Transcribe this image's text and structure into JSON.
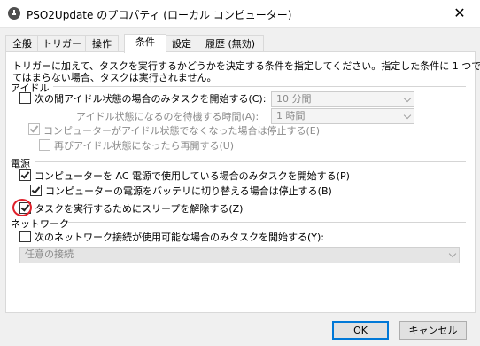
{
  "window": {
    "title": "PSO2Update のプロパティ (ローカル コンピューター)",
    "close_glyph": "✕",
    "icon": "clock-icon"
  },
  "tabs": [
    {
      "label": "全般"
    },
    {
      "label": "トリガー"
    },
    {
      "label": "操作"
    },
    {
      "label": "条件",
      "active": true
    },
    {
      "label": "設定"
    },
    {
      "label": "履歴 (無効)"
    }
  ],
  "description": {
    "line1": "トリガーに加えて、タスクを実行するかどうかを決定する条件を指定してください。指定した条件に 1 つでもあ",
    "line2": "てはまらない場合、タスクは実行されません。"
  },
  "idle": {
    "header": "アイドル",
    "start_only_if_idle": {
      "label": "次の間アイドル状態の場合のみタスクを開始する(C):",
      "checked": false
    },
    "idle_for": "10 分間",
    "wait_for_idle_label": "アイドル状態になるのを待機する時間(A):",
    "wait_for_idle": "1 時間",
    "stop_if_not_idle": {
      "label": "コンピューターがアイドル状態でなくなった場合は停止する(E)",
      "checked": true
    },
    "restart_if_idle": {
      "label": "再びアイドル状態になったら再開する(U)",
      "checked": false
    }
  },
  "power": {
    "header": "電源",
    "ac_only": {
      "label": "コンピューターを AC 電源で使用している場合のみタスクを開始する(P)",
      "checked": true
    },
    "stop_on_battery": {
      "label": "コンピューターの電源をバッテリに切り替える場合は停止する(B)",
      "checked": true
    },
    "wake": {
      "label": "タスクを実行するためにスリープを解除する(Z)",
      "checked": true
    }
  },
  "network": {
    "header": "ネットワーク",
    "only_if_available": {
      "label": "次のネットワーク接続が使用可能な場合のみタスクを開始する(Y):",
      "checked": false
    },
    "connection": "任意の接続"
  },
  "buttons": {
    "ok": "OK",
    "cancel": "キャンセル"
  },
  "colors": {
    "highlight_circle": "#e0202a",
    "default_button_border": "#0078d7"
  }
}
